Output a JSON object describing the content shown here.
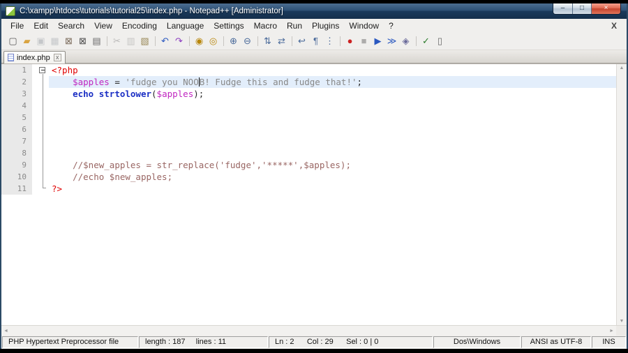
{
  "window": {
    "title": "C:\\xampp\\htdocs\\tutorials\\tutorial25\\index.php - Notepad++ [Administrator]",
    "controls": {
      "minimize": "–",
      "maximize": "□",
      "close": "×"
    }
  },
  "menu": {
    "items": [
      "File",
      "Edit",
      "Search",
      "View",
      "Encoding",
      "Language",
      "Settings",
      "Macro",
      "Run",
      "Plugins",
      "Window",
      "?"
    ],
    "close_label": "X"
  },
  "toolbar": {
    "groups": [
      [
        {
          "name": "new-file-icon",
          "glyph": "▢",
          "color": "#5a5a5a"
        },
        {
          "name": "open-folder-icon",
          "glyph": "▰",
          "color": "#d9a441"
        },
        {
          "name": "save-icon",
          "glyph": "▣",
          "color": "#5b82b8",
          "disabled": true
        },
        {
          "name": "save-all-icon",
          "glyph": "▦",
          "color": "#5b82b8",
          "disabled": true
        },
        {
          "name": "close-file-icon",
          "glyph": "⊠",
          "color": "#7a6a5a"
        },
        {
          "name": "close-all-icon",
          "glyph": "⊠",
          "color": "#4a4a4a"
        },
        {
          "name": "print-icon",
          "glyph": "▤",
          "color": "#6a6a6a"
        }
      ],
      [
        {
          "name": "cut-icon",
          "glyph": "✂",
          "color": "#555555",
          "disabled": true
        },
        {
          "name": "copy-icon",
          "glyph": "▥",
          "color": "#777777",
          "disabled": true
        },
        {
          "name": "paste-icon",
          "glyph": "▧",
          "color": "#9a8a5a"
        }
      ],
      [
        {
          "name": "undo-icon",
          "glyph": "↶",
          "color": "#2a58c0"
        },
        {
          "name": "redo-icon",
          "glyph": "↷",
          "color": "#8a3ac0"
        }
      ],
      [
        {
          "name": "find-icon",
          "glyph": "◉",
          "color": "#b8860b"
        },
        {
          "name": "replace-icon",
          "glyph": "◎",
          "color": "#b8860b"
        }
      ],
      [
        {
          "name": "zoom-in-icon",
          "glyph": "⊕",
          "color": "#4a6a9a"
        },
        {
          "name": "zoom-out-icon",
          "glyph": "⊖",
          "color": "#4a6a9a"
        }
      ],
      [
        {
          "name": "sync-vertical-icon",
          "glyph": "⇅",
          "color": "#4a6a9a"
        },
        {
          "name": "sync-horizontal-icon",
          "glyph": "⇄",
          "color": "#4a6a9a"
        }
      ],
      [
        {
          "name": "word-wrap-icon",
          "glyph": "↩",
          "color": "#4a6a9a"
        },
        {
          "name": "show-all-characters-icon",
          "glyph": "¶",
          "color": "#4a6a9a"
        },
        {
          "name": "indent-guide-icon",
          "glyph": "⋮",
          "color": "#4a6a9a"
        }
      ],
      [
        {
          "name": "record-macro-icon",
          "glyph": "●",
          "color": "#cc2222"
        },
        {
          "name": "stop-macro-icon",
          "glyph": "■",
          "color": "#333333",
          "disabled": true
        },
        {
          "name": "play-macro-icon",
          "glyph": "▶",
          "color": "#2a58c0"
        },
        {
          "name": "run-macro-multiple-icon",
          "glyph": "≫",
          "color": "#2a58c0"
        },
        {
          "name": "save-macro-icon",
          "glyph": "◈",
          "color": "#6a6a9a"
        }
      ],
      [
        {
          "name": "spell-check-icon",
          "glyph": "✓",
          "color": "#2a7a2a"
        },
        {
          "name": "document-map-icon",
          "glyph": "▯",
          "color": "#6a6a6a"
        }
      ]
    ]
  },
  "tabbar": {
    "tabs": [
      {
        "label": "index.php",
        "active": true,
        "close": "x"
      }
    ]
  },
  "editor": {
    "palette": {
      "plain": "#000000",
      "tag": "#e00000",
      "var": "#c026c0",
      "op": "#282828",
      "str": "#888888",
      "kw": "#1b2fc4",
      "func": "#1b2fc4",
      "comment": "#996663"
    },
    "lines": [
      {
        "num": 1,
        "fold": "open",
        "segments": [
          {
            "t": "<?php",
            "c": "tag"
          }
        ]
      },
      {
        "num": 2,
        "current": true,
        "fold": "line",
        "segments": [
          {
            "t": "    ",
            "c": "plain"
          },
          {
            "t": "$apples",
            "c": "var"
          },
          {
            "t": " = ",
            "c": "op"
          },
          {
            "t": "'fudge you NOO",
            "c": "str"
          },
          {
            "caret": true
          },
          {
            "t": "B! Fudge this and fudge that!'",
            "c": "str"
          },
          {
            "t": ";",
            "c": "op"
          }
        ]
      },
      {
        "num": 3,
        "fold": "line",
        "segments": [
          {
            "t": "    ",
            "c": "plain"
          },
          {
            "t": "echo",
            "c": "kw",
            "b": true
          },
          {
            "t": " ",
            "c": "plain"
          },
          {
            "t": "strtolower",
            "c": "func",
            "b": true
          },
          {
            "t": "(",
            "c": "op"
          },
          {
            "t": "$apples",
            "c": "var"
          },
          {
            "t": ");",
            "c": "op"
          }
        ]
      },
      {
        "num": 4,
        "fold": "line",
        "segments": []
      },
      {
        "num": 5,
        "fold": "line",
        "segments": []
      },
      {
        "num": 6,
        "fold": "line",
        "segments": []
      },
      {
        "num": 7,
        "fold": "line",
        "segments": []
      },
      {
        "num": 8,
        "fold": "line",
        "segments": []
      },
      {
        "num": 9,
        "fold": "line",
        "segments": [
          {
            "t": "    ",
            "c": "plain"
          },
          {
            "t": "//$new_apples = str_replace('fudge','*****',$apples);",
            "c": "comment"
          }
        ]
      },
      {
        "num": 10,
        "fold": "line",
        "segments": [
          {
            "t": "    ",
            "c": "plain"
          },
          {
            "t": "//echo $new_apples;",
            "c": "comment"
          }
        ]
      },
      {
        "num": 11,
        "fold": "end",
        "segments": [
          {
            "t": "?>",
            "c": "tag"
          }
        ]
      }
    ]
  },
  "statusbar": {
    "file_type": "PHP Hypertext Preprocessor file",
    "length_lines": "length : 187     lines : 11",
    "position": "Ln : 2      Col : 29      Sel : 0 | 0",
    "eol": "Dos\\Windows",
    "encoding": "ANSI as UTF-8",
    "insert_mode": "INS"
  }
}
